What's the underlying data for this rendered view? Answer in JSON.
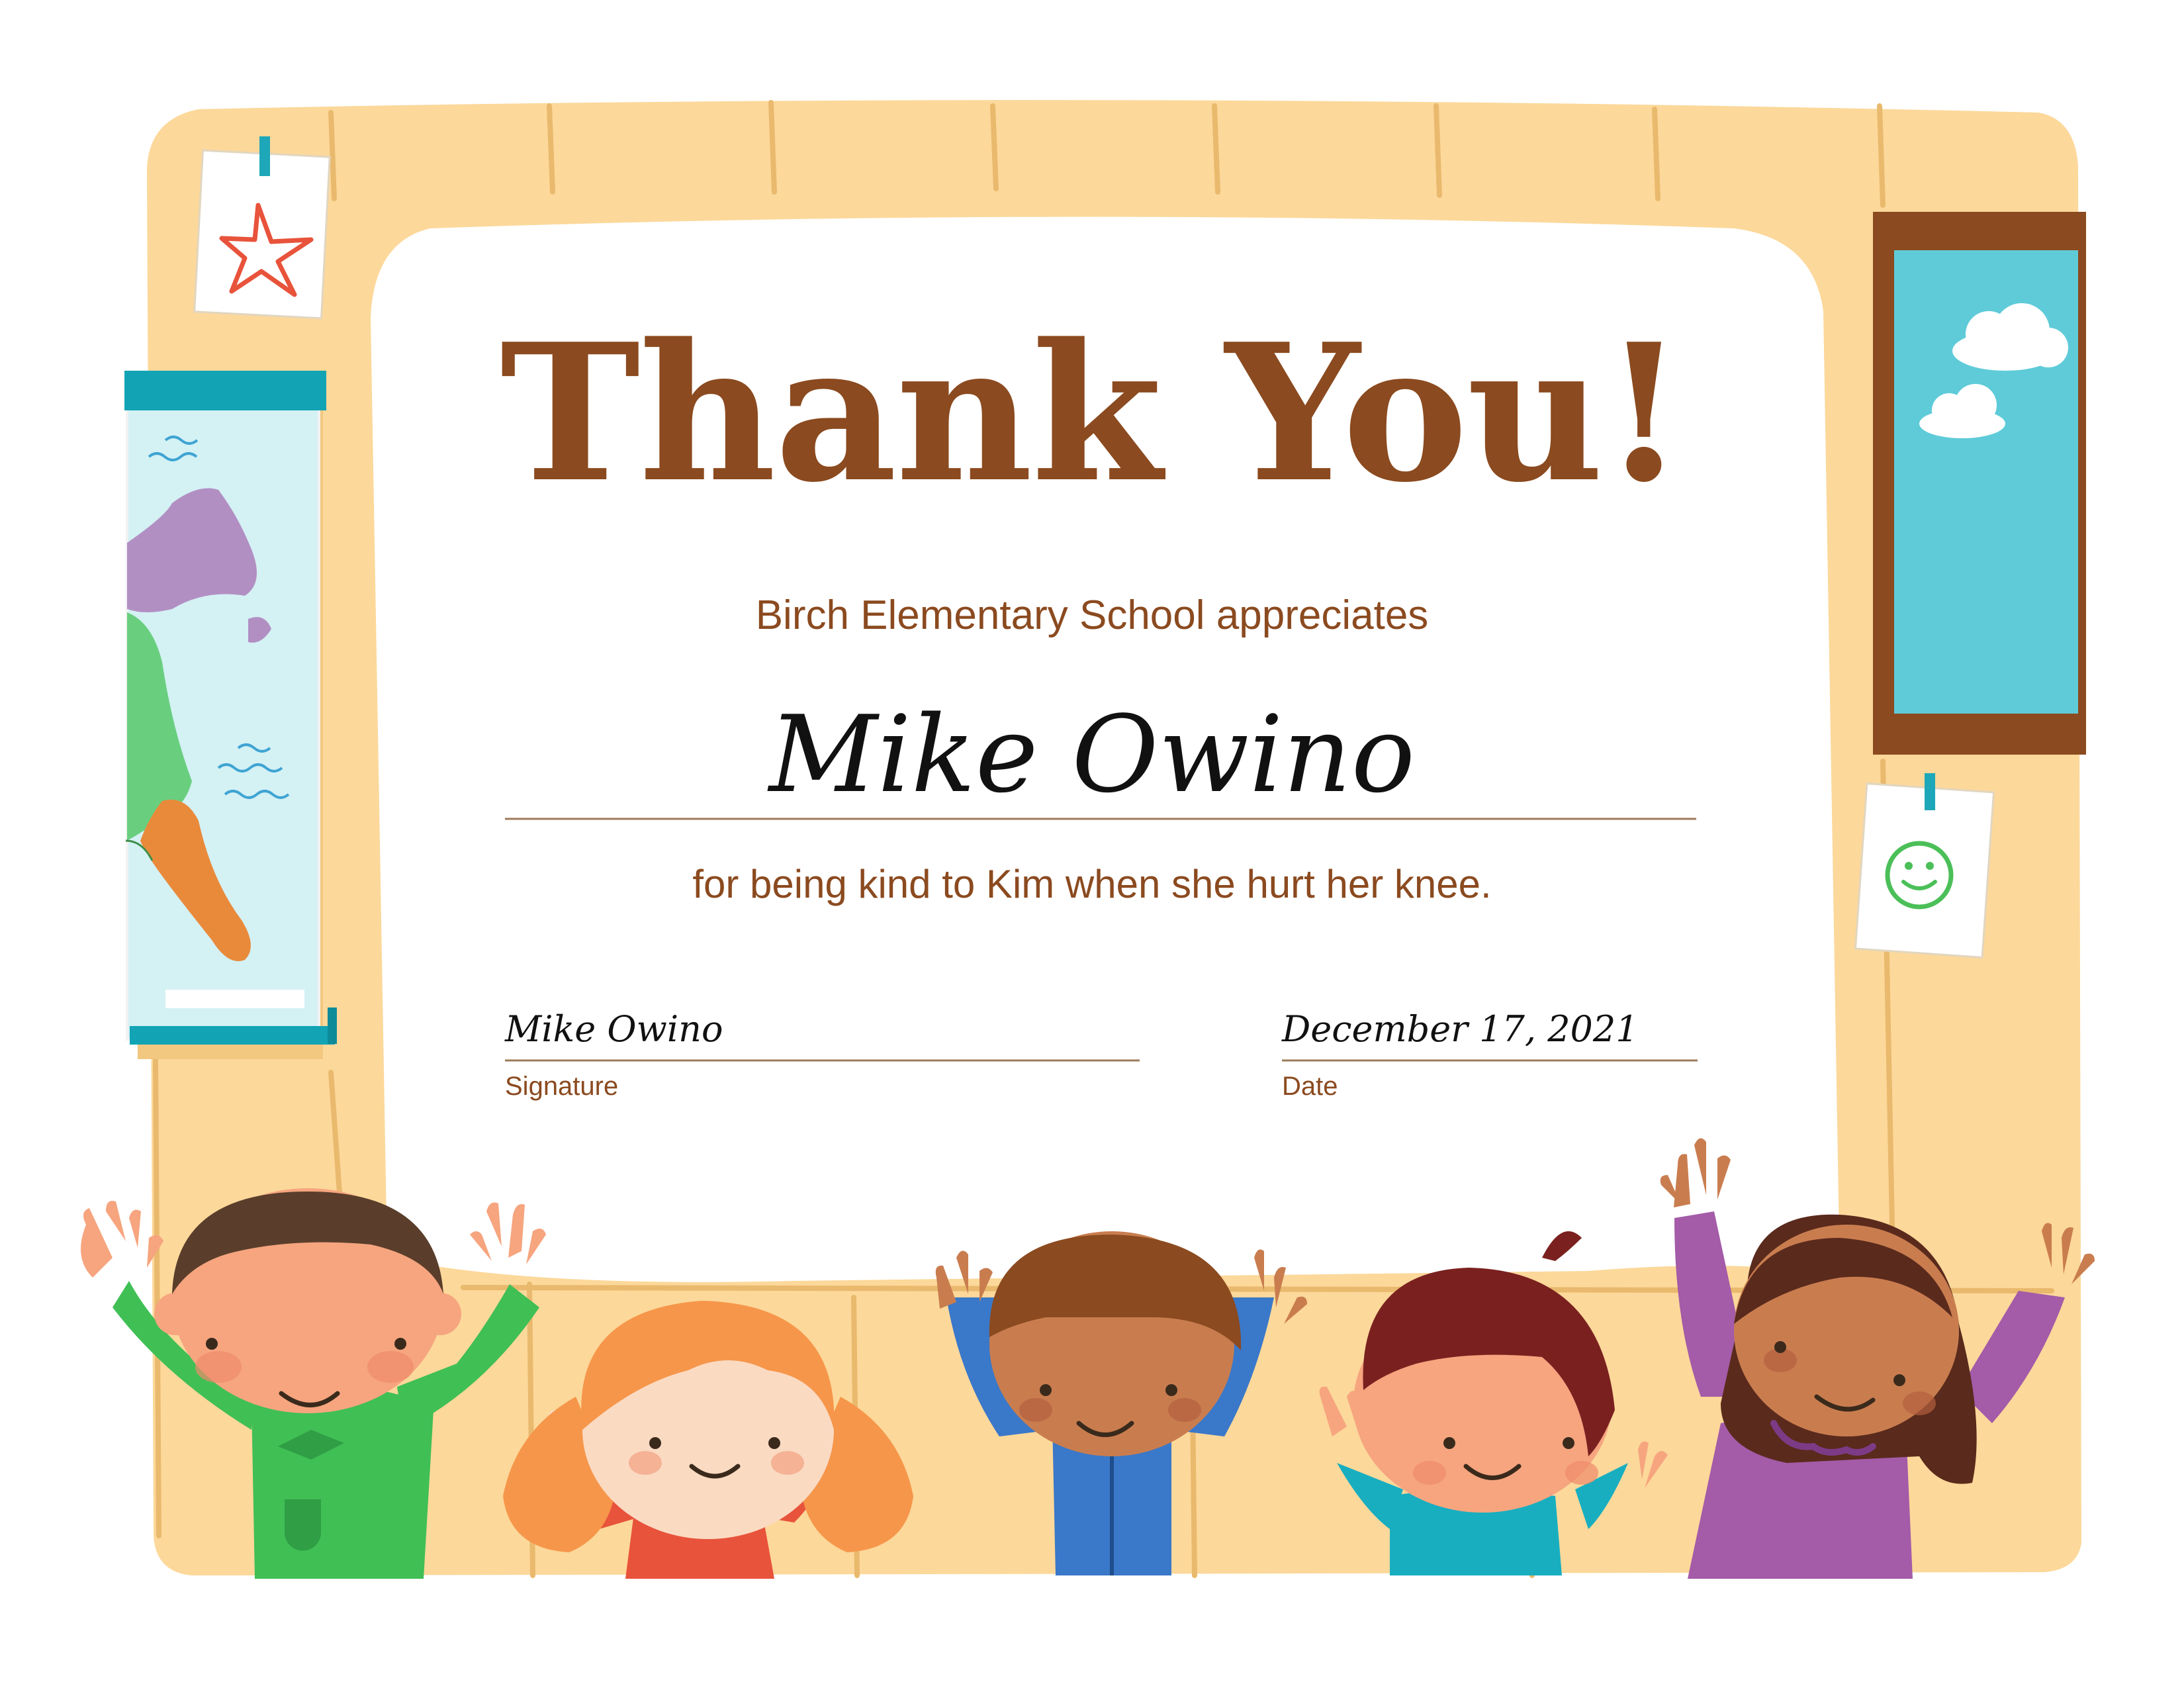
{
  "certificate": {
    "title": "Thank You!",
    "subtitle": "Birch Elementary School appreciates",
    "recipient": "Mike Owino",
    "reason": "for being kind to Kim when she hurt her knee.",
    "signature_value": "Mike Owino",
    "signature_label": "Signature",
    "date_value": "December 17, 2021",
    "date_label": "Date"
  },
  "colors": {
    "frame": "#fcd89a",
    "text_brown": "#8b4a1f",
    "line": "#9c7b5a"
  },
  "illustrations": [
    "star-drawing-icon",
    "world-map",
    "window-with-clouds",
    "smiley-drawing-icon",
    "children-waving"
  ]
}
